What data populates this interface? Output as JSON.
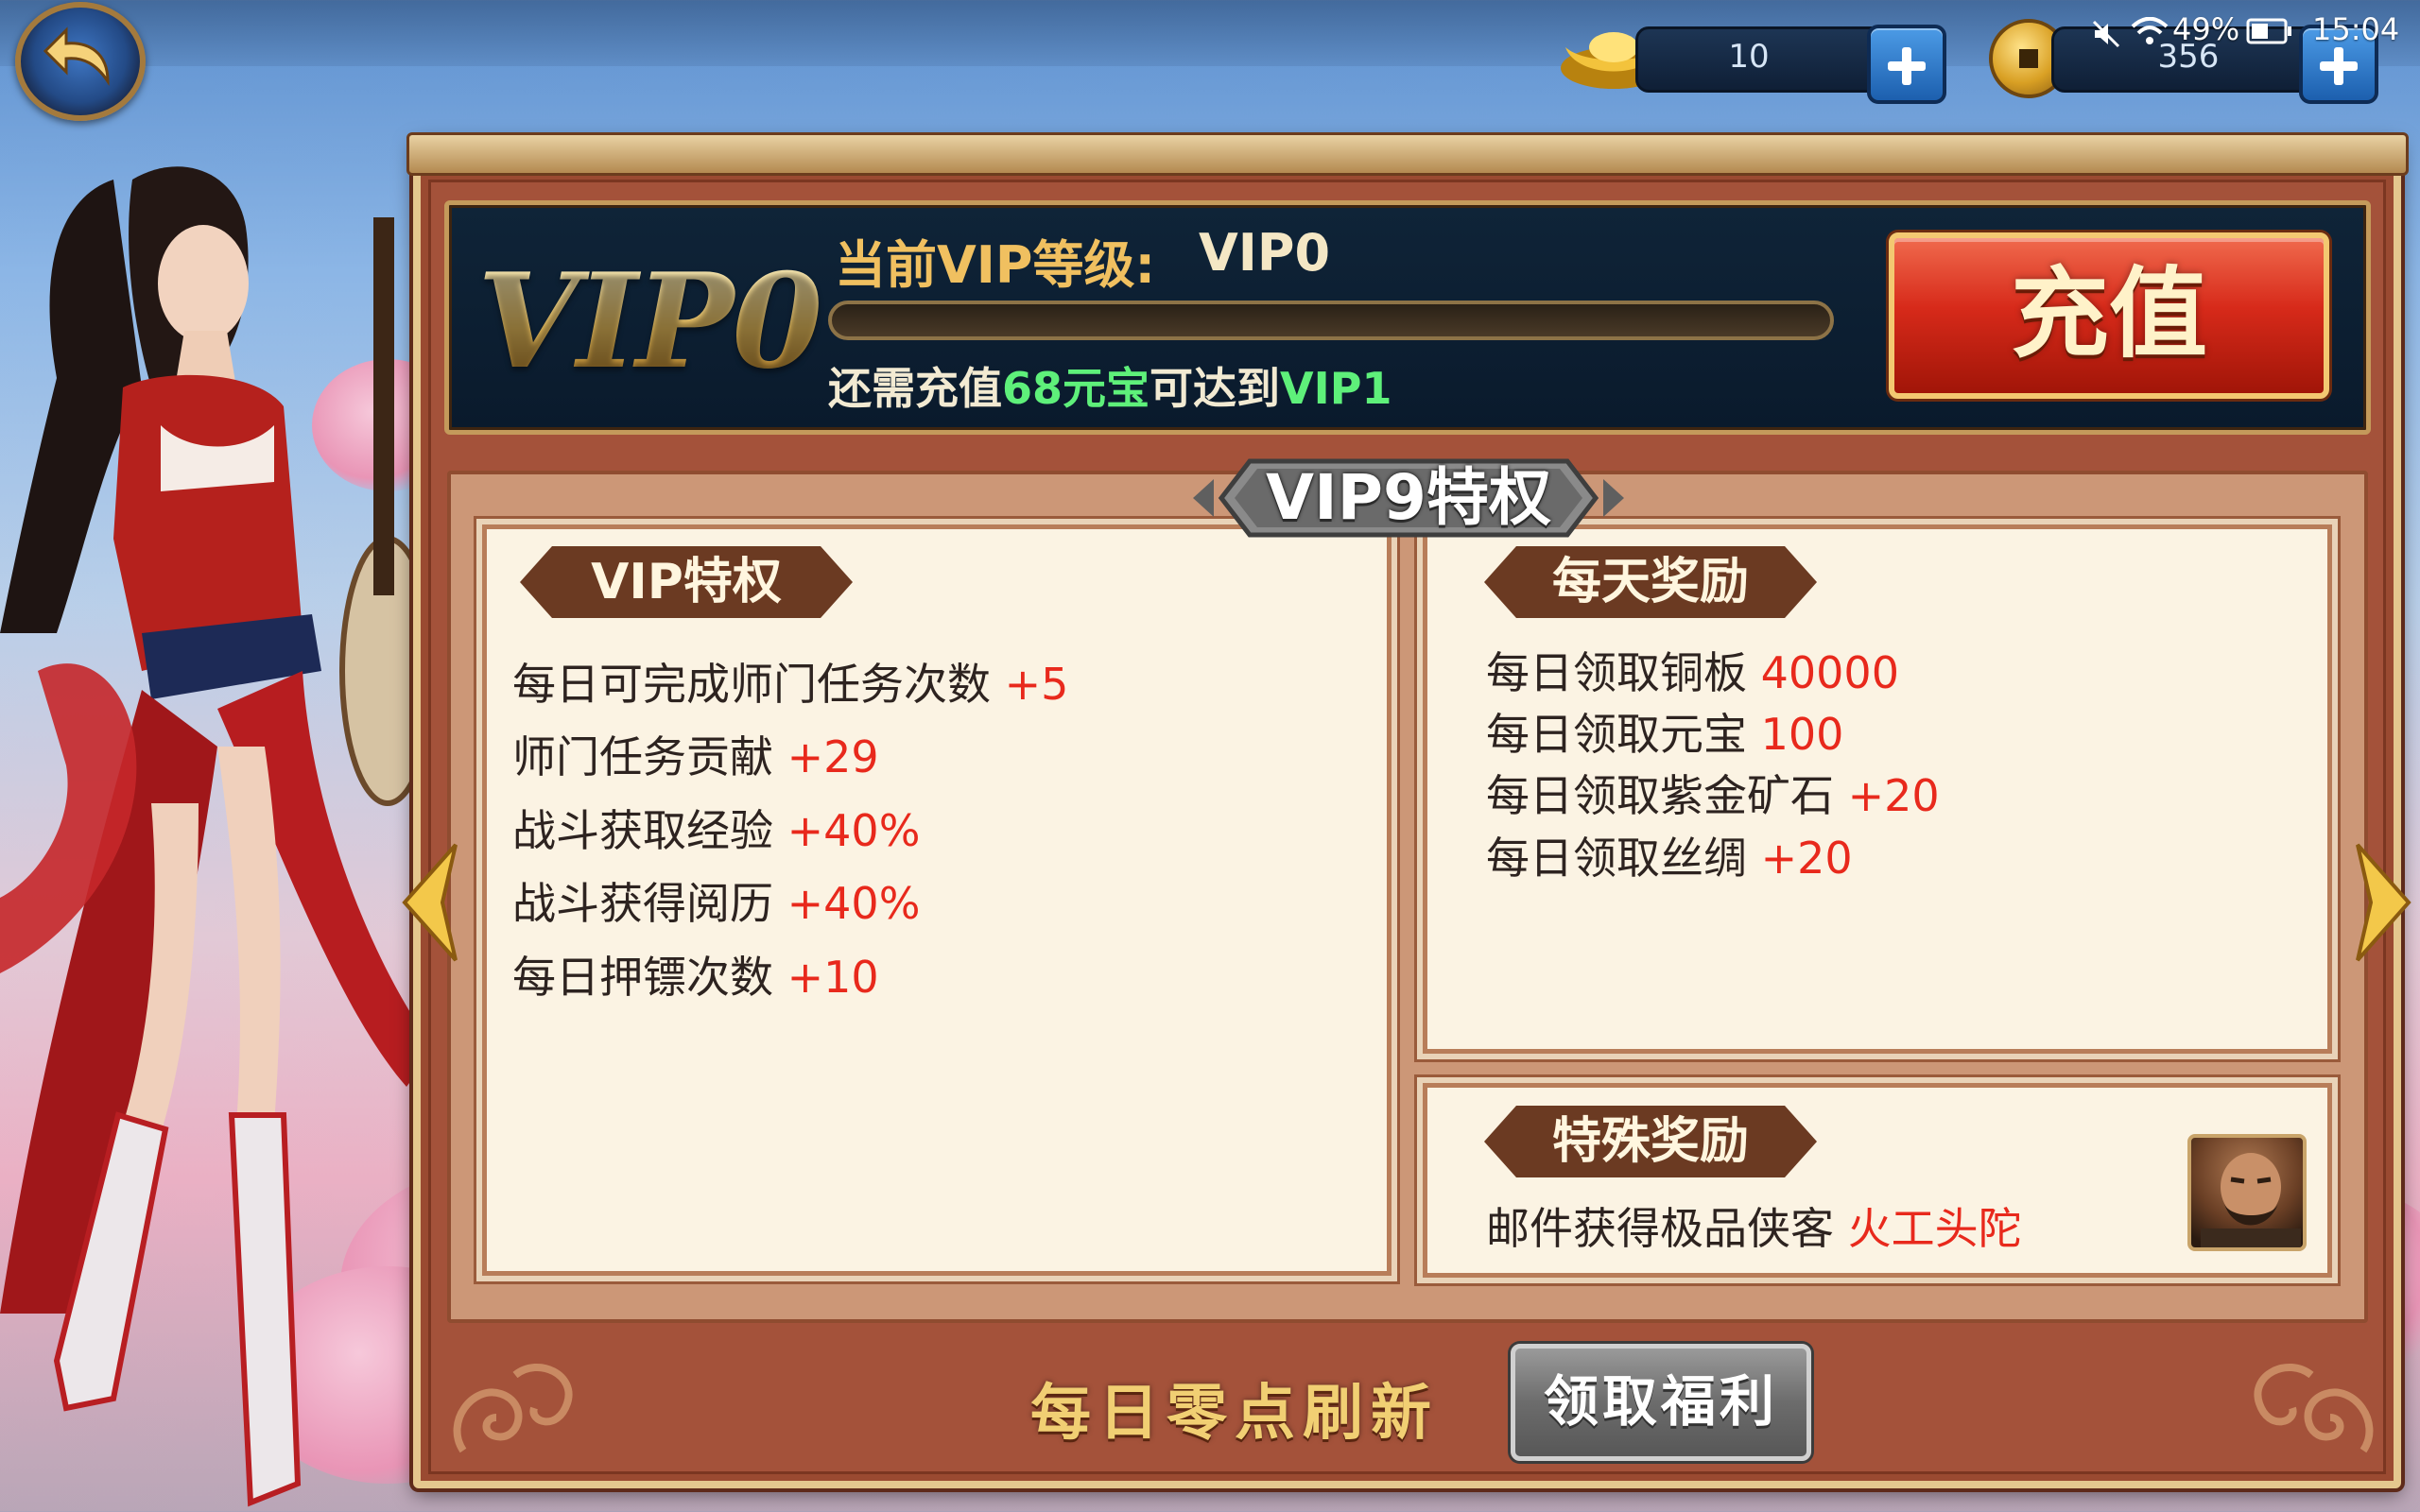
{
  "topbar": {
    "gold_value": "10",
    "coins_value": "356",
    "status_battery": "49%",
    "status_time": "15:04"
  },
  "vip_header": {
    "big_level": "VIP0",
    "current_label": "当前VIP等级:",
    "current_value": "VIP0",
    "progress_fraction": 0,
    "need_prefix": "还需充值",
    "need_amount": "68元宝",
    "need_mid": "可达到",
    "need_target": "VIP1",
    "charge_button": "充值"
  },
  "page_banner": "VIP9特权",
  "privileges": {
    "title": "VIP特权",
    "items": [
      {
        "text": "每日可完成师门任务次数",
        "value": "+5"
      },
      {
        "text": "师门任务贡献",
        "value": "+29"
      },
      {
        "text": "战斗获取经验",
        "value": "+40%"
      },
      {
        "text": "战斗获得阅历",
        "value": "+40%"
      },
      {
        "text": "每日押镖次数",
        "value": "+10"
      }
    ]
  },
  "daily_rewards": {
    "title": "每天奖励",
    "items": [
      {
        "text": "每日领取铜板",
        "value": "40000"
      },
      {
        "text": "每日领取元宝",
        "value": "100"
      },
      {
        "text": "每日领取紫金矿石",
        "value": "+20"
      },
      {
        "text": "每日领取丝绸",
        "value": "+20"
      }
    ]
  },
  "special_reward": {
    "title": "特殊奖励",
    "text": "邮件获得极品侠客",
    "value": "火工头陀"
  },
  "footer": {
    "refresh_note": "每日零点刷新",
    "claim_button": "领取福利"
  },
  "colors": {
    "frame": "#9a4a31",
    "header_bg": "#0f2438",
    "gold": "#f0c060",
    "value_red": "#e8291c",
    "value_green": "#5ef07a",
    "panel_bg": "#fbf3e3",
    "tag_brown": "#6b3a22"
  },
  "icons": [
    "back-icon",
    "gold-ingot-icon",
    "copper-coin-icon",
    "plus-icon",
    "mute-icon",
    "wifi-icon",
    "battery-icon",
    "left-arrow-icon",
    "right-arrow-icon",
    "hero-avatar-icon"
  ]
}
